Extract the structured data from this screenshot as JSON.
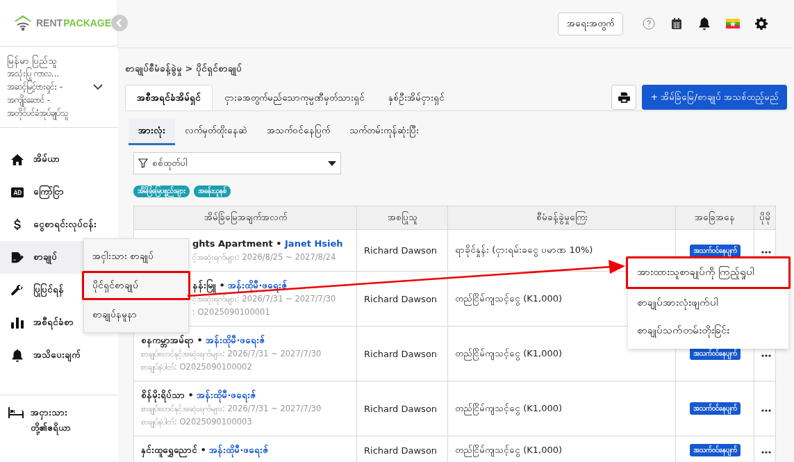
{
  "logo": {
    "word1": "RENT",
    "word2": "PACKAGE"
  },
  "account": {
    "lines": [
      "မြန်မာ ပြည်သူ",
      "အသုံးပြု ကာလ...",
      "အဆင့်မြင့်ဗားရှင်း -",
      "အကျိုးဆောင် -",
      "အတိုင်ပင်ခံအုပ်ချုပ်သူ"
    ]
  },
  "nav": [
    {
      "label": "အိမ်ယာ",
      "selected": false
    },
    {
      "label": "ကြော်ငြာ",
      "selected": false
    },
    {
      "label": "ငွေစာရင်းလုပ်ငန်း",
      "selected": false
    },
    {
      "label": "စာချုပ်",
      "selected": true
    },
    {
      "label": "ပြုပြင်ရန်",
      "selected": false
    },
    {
      "label": "အစီရင်ခံစာ",
      "selected": false
    },
    {
      "label": "အသိပေးချက်",
      "selected": false
    }
  ],
  "tenant_area": {
    "label": "အငှားသား တို့၏ဧရိယာ"
  },
  "flyout": [
    {
      "label": "အငှါးသား စာချုပ်",
      "highlighted": false
    },
    {
      "label": "ပိုင်ရှင်စာချုပ်",
      "highlighted": true
    },
    {
      "label": "စာချုပ်နမူနာ",
      "highlighted": false
    }
  ],
  "topbar": {
    "button": "အရေးအတွက်"
  },
  "breadcrumb": "စာချုပ်စီမံခန့်ခွဲမှု > ပိုင်ရှင်စာချုပ်",
  "tabs": [
    {
      "label": "အစီအရင်ခံအိမ်ရှင်",
      "selected": true
    },
    {
      "label": "ငှားခအတွက်မည်သောကုမ္ပဏီမှတ်သားရှင်",
      "selected": false
    },
    {
      "label": "နှစ်ဦးအိမ်ငှားရှင်",
      "selected": false
    }
  ],
  "add_button": "+ အိမ်ခြံမြေ/စာချုပ် အသစ်ထည့်မည်",
  "subtabs": [
    {
      "label": "အားလုံး",
      "selected": true
    },
    {
      "label": "လက်မှတ်ထိုးနေဆဲ",
      "selected": false
    },
    {
      "label": "အသက်ဝင်နေပြက်",
      "selected": false
    },
    {
      "label": "သက်တမ်းကုန်ဆုံးပြီး",
      "selected": false
    }
  ],
  "filter": {
    "placeholder": "စစ်ထုတ်ပါ"
  },
  "chips": [
    "အိမ်ခြံမြေပစ္စည်းများ",
    "အခန်းယူနစ်"
  ],
  "table": {
    "columns": [
      "အိမ်ခြံမြေအချက်အလက်",
      "အစပြုသူ",
      "စီမံခန့်ခွဲမှုကြေး",
      "အခြေအနေ",
      "ပိုမို"
    ],
    "rows": [
      {
        "under_menu": true,
        "title": "ghts Apartment •",
        "owner": "Janet Hsieh",
        "lines": [
          "င့်အဆုံးရက်များ: 2026/8/25 ~ 2027/8/24"
        ],
        "initiator": "Richard Dawson",
        "fee": "ရာခိုင်နှုန်း (ငှားရမ်းခငွေ ပမာဏ 10%)",
        "status": "အသက်ဝင်နေပျက်",
        "more": true
      },
      {
        "under_menu": true,
        "title": "နန်းမြူ •",
        "owner": "အန်းထိုမီ·ဖရေးဇ်",
        "lines": [
          "င့်အဆုံးရက်များ: 2026/7/31 ~ 2027/7/30",
          ": O2025090100001"
        ],
        "initiator": "Richard Dawson",
        "fee": "တည်ငြိမ်ကျသင့်ငွေ (K1,000)",
        "more": false
      },
      {
        "under_menu": false,
        "title": "စနကမ္ဘာအမ်ရာ •",
        "owner": "အန်းထိုမီ·ဖရေးဇ်",
        "lines": [
          "စာချုပ်စတင်နှင့်အဆုံးရက်များ: 2026/7/31 ~ 2027/7/30",
          "စာချုပ်နံပါတ်: O2025090100002"
        ],
        "initiator": "Richard Dawson",
        "fee": "တည်ငြိမ်ကျသင့်ငွေ (K1,000)",
        "status": "အသက်ဝင်နေပျက်",
        "more": true
      },
      {
        "under_menu": false,
        "title": "စိန်မိုးရိပ်သာ •",
        "owner": "အန်းထိုမီ·ဖရေးဇ်",
        "lines": [
          "စာချုပ်စတင်နှင့်အဆုံးရက်များ: 2026/7/31 ~ 2027/7/30",
          "စာချုပ်နံပါတ်: O2025090100003"
        ],
        "initiator": "Richard Dawson",
        "fee": "တည်ငြိမ်ကျသင့်ငွေ (K1,000)",
        "status": "အသက်ဝင်နေပျက်",
        "more": true
      },
      {
        "under_menu": false,
        "title": "နှင်းထူရွှေညောင် •",
        "owner": "အန်းထိုမီ·ဖရေးဇ်",
        "lines": [],
        "initiator": "Richard Dawson",
        "fee": "တည်ငြိမ်ကျသင့်ငွေ (K1,000)",
        "status": "အသက်ဝင်နေပျက်",
        "more": true
      }
    ]
  },
  "context_menu": [
    {
      "label": "အားထားသူစာချုပ်ကို ကြည့်ရှုပါ",
      "highlighted": true
    },
    {
      "label": "စာချုပ်အားလုံးဖျက်ပါ",
      "highlighted": false
    },
    {
      "label": "စာချုပ်သက်တမ်းတိုးခြင်း",
      "highlighted": false
    }
  ]
}
